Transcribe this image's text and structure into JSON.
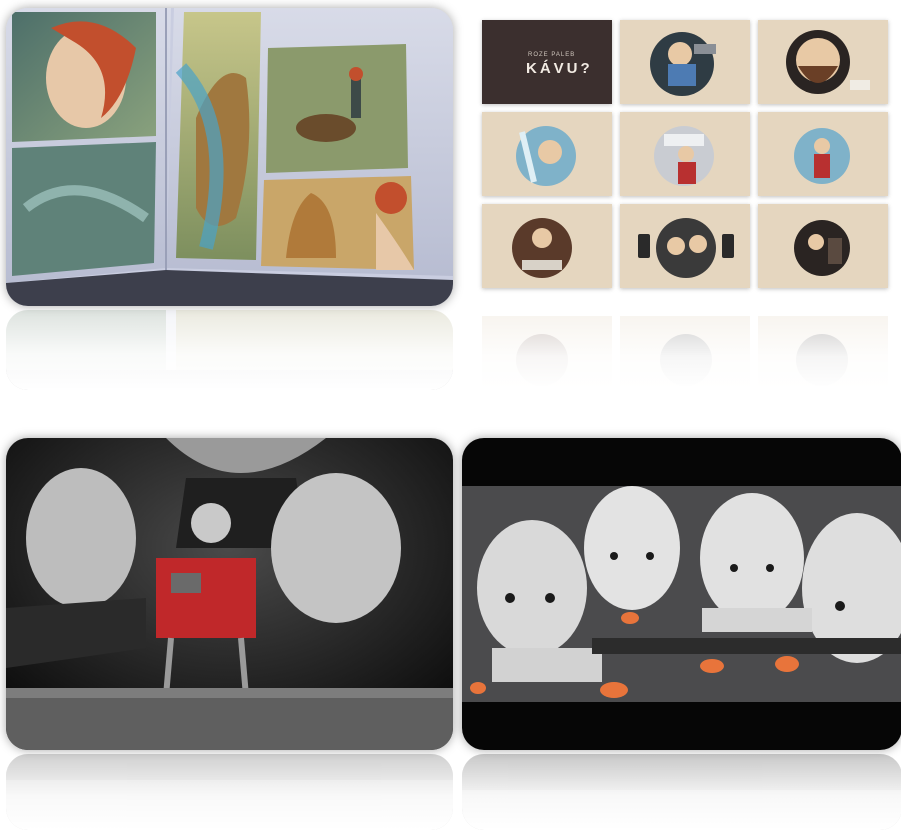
{
  "gallery": {
    "tiles": [
      {
        "name": "comic-book-photo",
        "subject": "illustrated comic book pages with a dog and a red-haired girl"
      },
      {
        "name": "coffee-illustrations-grid",
        "subject": "grid of nine circular cartoon illustrations on beige cards"
      },
      {
        "name": "robot-figure-photo",
        "subject": "hands assembling a small metal robot figure with a light bulb head"
      },
      {
        "name": "puppets-photo",
        "subject": "row of white stitched puppet figures in a dim room"
      }
    ],
    "kavu_card": {
      "small_text": "ROZE PALEB",
      "title": "KÁVU?"
    }
  },
  "colors": {
    "comic_bg": "#6f8a77",
    "kavu_cell": "#e5d6bf",
    "kavu_dark": "#3b2f2e",
    "robot_red": "#c0282a",
    "puppet_orange": "#e8743b"
  }
}
